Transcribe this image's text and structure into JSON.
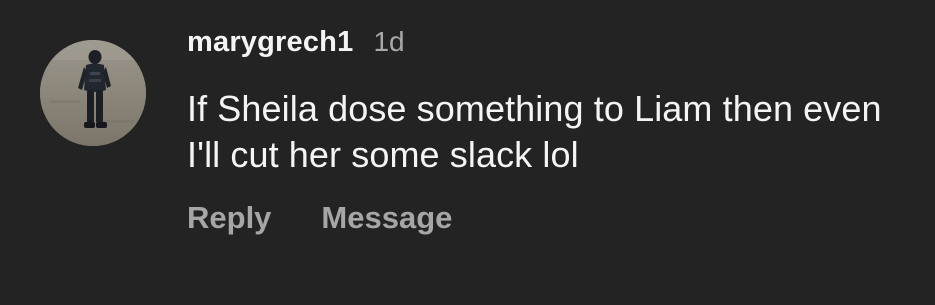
{
  "comment": {
    "username": "marygrech1",
    "timestamp": "1d",
    "text": "If Sheila dose something to Liam then even I'll cut her some slack lol",
    "avatar_icon": "avatar-photo",
    "actions": {
      "reply_label": "Reply",
      "message_label": "Message"
    }
  },
  "colors": {
    "background": "#232323",
    "primary_text": "#f4f4f4",
    "secondary_text": "#a8a8a8"
  }
}
